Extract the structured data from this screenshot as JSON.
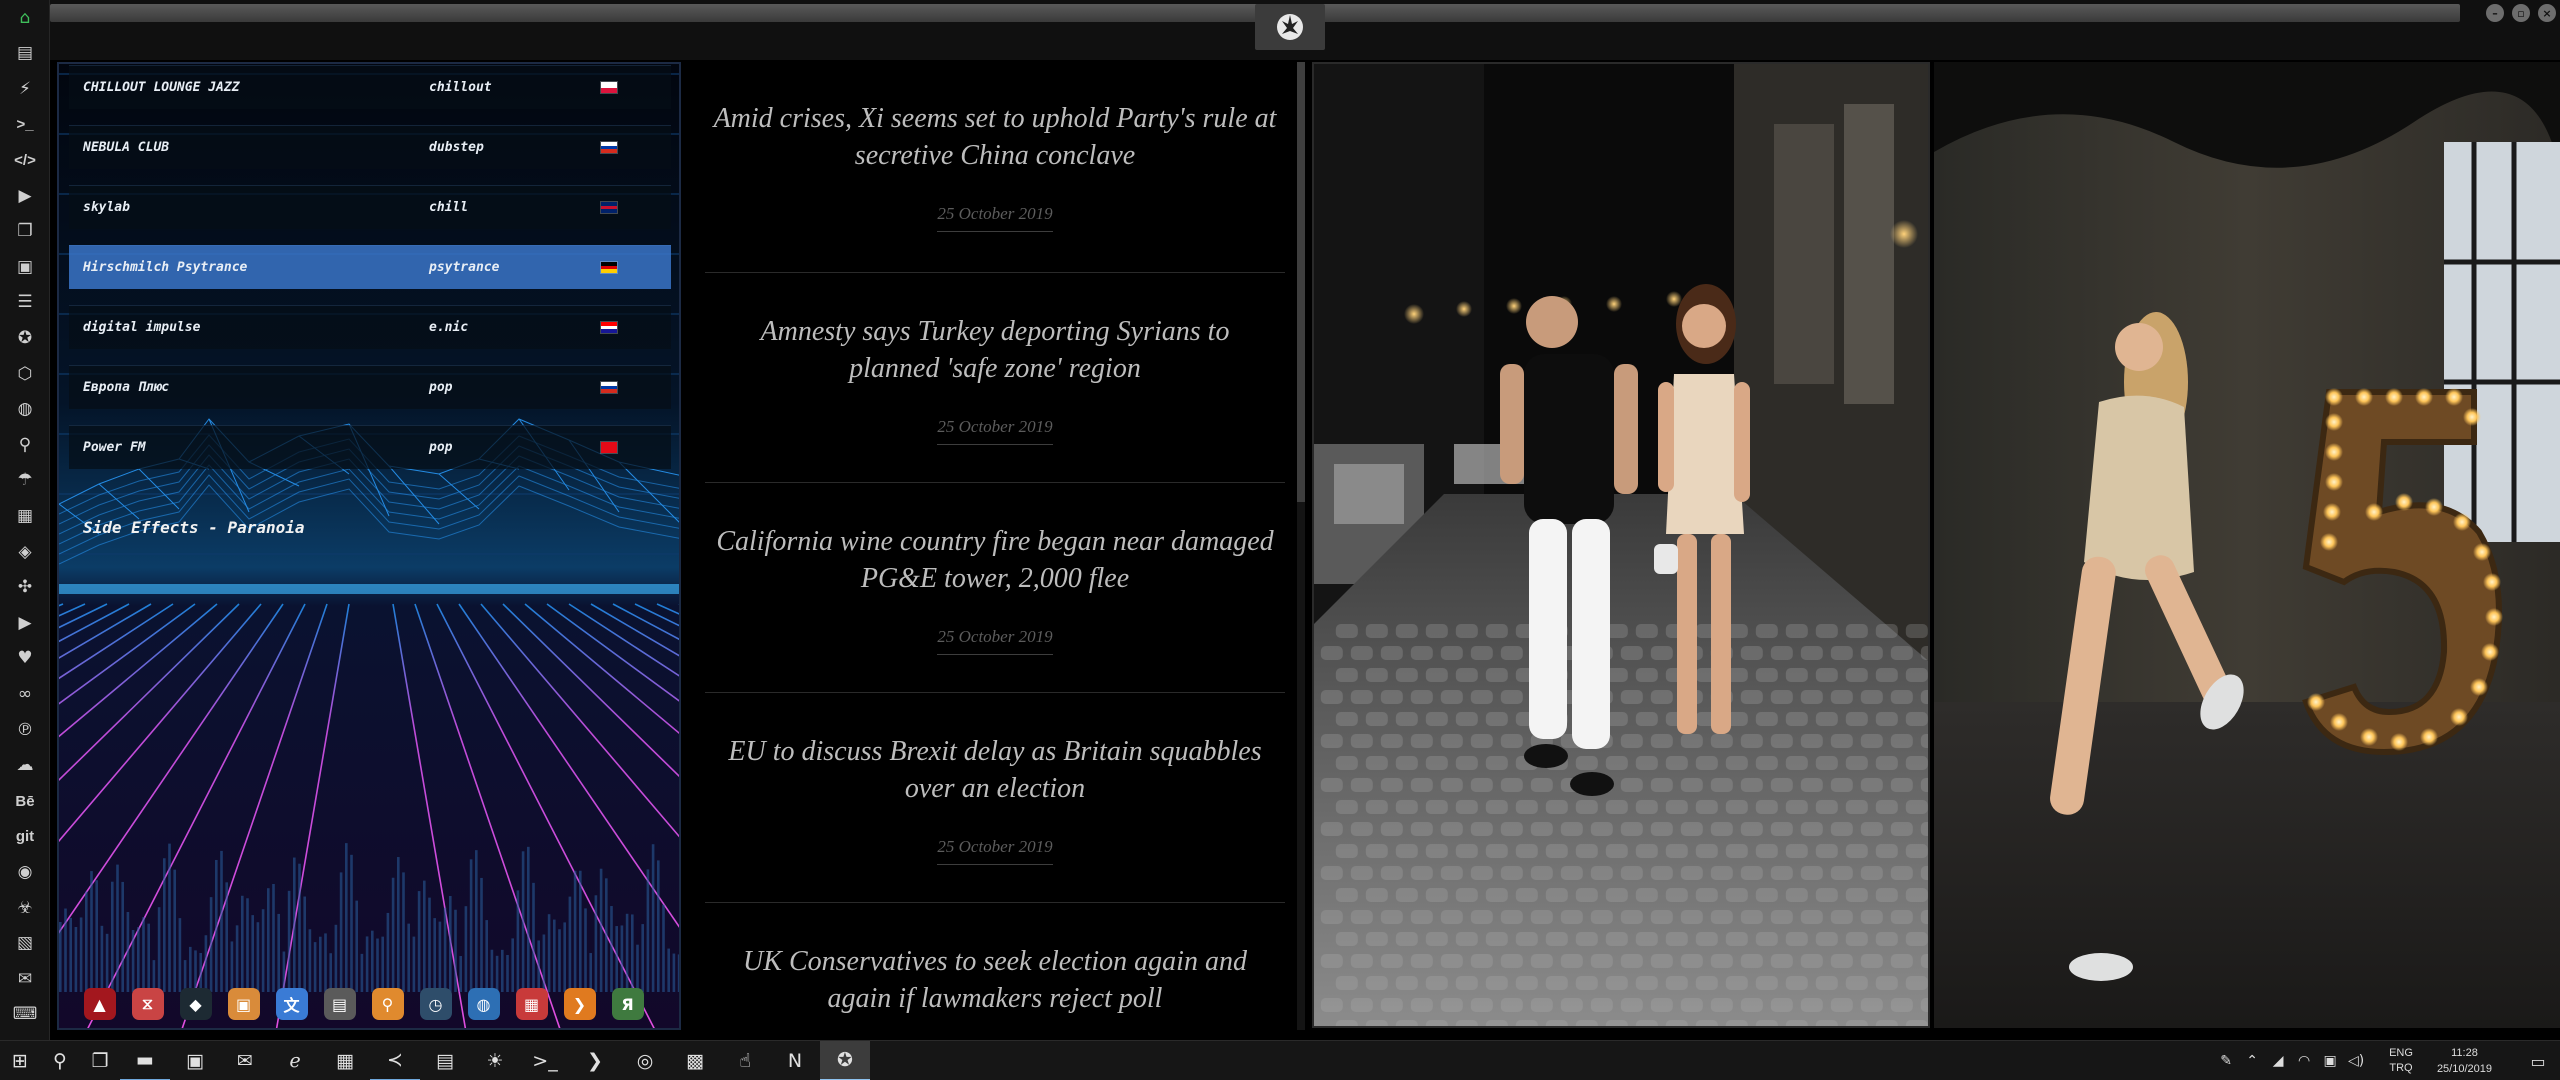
{
  "sidebar": {
    "icons": [
      {
        "name": "home-icon",
        "glyph": "⌂"
      },
      {
        "name": "document-icon",
        "glyph": "▤"
      },
      {
        "name": "lightning-icon",
        "glyph": "⚡"
      },
      {
        "name": "terminal-icon",
        "glyph": ">_"
      },
      {
        "name": "code-icon",
        "glyph": "</>"
      },
      {
        "name": "play-icon",
        "glyph": "▶"
      },
      {
        "name": "copy-icon",
        "glyph": "❐"
      },
      {
        "name": "image-icon",
        "glyph": "▣"
      },
      {
        "name": "newspaper-icon",
        "glyph": "☰"
      },
      {
        "name": "rebel-emblem-icon",
        "glyph": "✪"
      },
      {
        "name": "hexagon-icon",
        "glyph": "⬡"
      },
      {
        "name": "globe-icon",
        "glyph": "◍"
      },
      {
        "name": "search-icon",
        "glyph": "⚲"
      },
      {
        "name": "umbrella-icon",
        "glyph": "☂"
      },
      {
        "name": "contact-icon",
        "glyph": "▦"
      },
      {
        "name": "tags-icon",
        "glyph": "◈"
      },
      {
        "name": "expand-icon",
        "glyph": "✣"
      },
      {
        "name": "youtube-icon",
        "glyph": "▶"
      },
      {
        "name": "heart-icon",
        "glyph": "♥"
      },
      {
        "name": "lastfm-icon",
        "glyph": "∞"
      },
      {
        "name": "pinterest-icon",
        "glyph": "℗"
      },
      {
        "name": "cloud-icon",
        "glyph": "☁"
      },
      {
        "name": "behance-icon",
        "glyph": "Bē"
      },
      {
        "name": "git-icon",
        "glyph": "git"
      },
      {
        "name": "github-icon",
        "glyph": "◉"
      },
      {
        "name": "biohazard-icon",
        "glyph": "☣"
      },
      {
        "name": "map-icon",
        "glyph": "▧"
      },
      {
        "name": "mail-icon",
        "glyph": "✉"
      },
      {
        "name": "keyboard-icon",
        "glyph": "⌨"
      }
    ]
  },
  "radio": {
    "stations": [
      {
        "name": "CHILLOUT LOUNGE JAZZ",
        "genre": "chillout",
        "flag": [
          "#ffffff",
          "#dc143c"
        ]
      },
      {
        "name": "NEBULA CLUB",
        "genre": "dubstep",
        "flag": [
          "#ffffff",
          "#0039a6",
          "#d52b1e"
        ]
      },
      {
        "name": "skylab",
        "genre": "chill",
        "flag": [
          "#012169",
          "#c8102e",
          "#012169"
        ]
      },
      {
        "name": "Hirschmilch Psytrance",
        "genre": "psytrance",
        "flag": [
          "#000000",
          "#dd0000",
          "#ffce00"
        ]
      },
      {
        "name": "digital impulse",
        "genre": "e.nic",
        "flag": [
          "#ff0000",
          "#ffffff",
          "#171796"
        ]
      },
      {
        "name": "Европа Плюс",
        "genre": "pop",
        "flag": [
          "#ffffff",
          "#0039a6",
          "#d52b1e"
        ]
      },
      {
        "name": "Power FM",
        "genre": "pop",
        "flag": [
          "#e30a17",
          "#e30a17"
        ]
      }
    ],
    "now_playing": "Side Effects - Paranoia"
  },
  "dock": {
    "apps": [
      {
        "name": "autodesk-icon",
        "glyph": "▲",
        "color": "#a3171e"
      },
      {
        "name": "timer-icon",
        "glyph": "⧖",
        "color": "#c94444"
      },
      {
        "name": "vpn-icon",
        "glyph": "◆",
        "color": "#1d2a33"
      },
      {
        "name": "finder-icon",
        "glyph": "▣",
        "color": "#d98b3a"
      },
      {
        "name": "translate-icon",
        "glyph": "文",
        "color": "#3a7bd5"
      },
      {
        "name": "notes-icon",
        "glyph": "▤",
        "color": "#5a5a5a"
      },
      {
        "name": "magnifier-icon",
        "glyph": "⚲",
        "color": "#e08a2e"
      },
      {
        "name": "clock-icon",
        "glyph": "◷",
        "color": "#2e4d6a"
      },
      {
        "name": "globe-icon",
        "glyph": "◍",
        "color": "#2d6fb4"
      },
      {
        "name": "calendar-icon",
        "glyph": "▦",
        "color": "#c83a3a"
      },
      {
        "name": "arrow-icon",
        "glyph": "❯",
        "color": "#e07a1f"
      },
      {
        "name": "yandex-icon",
        "glyph": "Я",
        "color": "#3f7a3f"
      }
    ]
  },
  "news": {
    "items": [
      {
        "title": "Amid crises, Xi seems set to uphold Party's rule at secretive China conclave",
        "date": "25 October 2019"
      },
      {
        "title": "Amnesty says Turkey deporting Syrians to planned 'safe zone' region",
        "date": "25 October 2019"
      },
      {
        "title": "California wine country fire began near damaged PG&E tower, 2,000 flee",
        "date": "25 October 2019"
      },
      {
        "title": "EU to discuss Brexit delay as Britain squabbles over an election",
        "date": "25 October 2019"
      },
      {
        "title": "UK Conservatives to seek election again and again if lawmakers reject poll",
        "date": "25 October 2019"
      }
    ]
  },
  "taskbar": {
    "apps": [
      {
        "name": "start-icon",
        "glyph": "⊞",
        "state": ""
      },
      {
        "name": "search-icon",
        "glyph": "⚲",
        "state": ""
      },
      {
        "name": "task-view-icon",
        "glyph": "❐",
        "state": ""
      },
      {
        "name": "file-explorer-icon",
        "glyph": "▬",
        "state": "running"
      },
      {
        "name": "store-icon",
        "glyph": "▣",
        "state": ""
      },
      {
        "name": "mail-icon",
        "glyph": "✉",
        "state": ""
      },
      {
        "name": "edge-icon",
        "glyph": "ℯ",
        "state": ""
      },
      {
        "name": "sandbox-icon",
        "glyph": "▦",
        "state": ""
      },
      {
        "name": "vscode-icon",
        "glyph": "≺",
        "state": "running"
      },
      {
        "name": "news-app-icon",
        "glyph": "▤",
        "state": ""
      },
      {
        "name": "brightness-icon",
        "glyph": "☀",
        "state": ""
      },
      {
        "name": "terminal-icon",
        "glyph": ">_",
        "state": ""
      },
      {
        "name": "powershell-icon",
        "glyph": "❯",
        "state": ""
      },
      {
        "name": "chrome-icon",
        "glyph": "◎",
        "state": ""
      },
      {
        "name": "remote-desktop-icon",
        "glyph": "▩",
        "state": ""
      },
      {
        "name": "pointer-icon",
        "glyph": "☝",
        "state": ""
      },
      {
        "name": "netflix-icon",
        "glyph": "N",
        "state": ""
      },
      {
        "name": "rebel-app-icon",
        "glyph": "✪",
        "state": "active"
      }
    ],
    "tray": [
      {
        "name": "pen-icon",
        "glyph": "✎"
      },
      {
        "name": "chevron-up-icon",
        "glyph": "⌃"
      },
      {
        "name": "network-icon",
        "glyph": "◢"
      },
      {
        "name": "wifi-icon",
        "glyph": "◠"
      },
      {
        "name": "security-icon",
        "glyph": "▣"
      },
      {
        "name": "volume-icon",
        "glyph": "◁)"
      }
    ],
    "lang_top": "ENG",
    "lang_bottom": "TRQ",
    "time": "11:28",
    "date": "25/10/2019"
  }
}
